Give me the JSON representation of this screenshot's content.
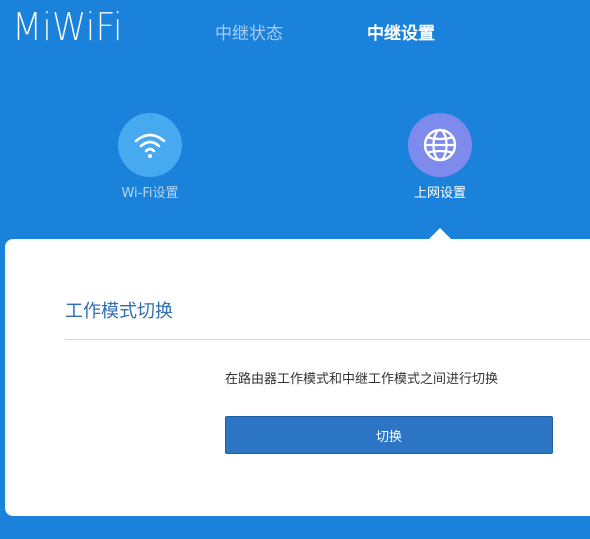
{
  "header": {
    "logo_text": "MiWiFi",
    "nav": {
      "status_label": "中继状态",
      "settings_label": "中继设置"
    }
  },
  "settings_menu": {
    "wifi_label": "Wi-Fi设置",
    "network_label": "上网设置",
    "wifi_icon": "wifi-icon",
    "network_icon": "globe-icon"
  },
  "panel": {
    "title": "工作模式切换",
    "description": "在路由器工作模式和中继工作模式之间进行切换",
    "switch_button_label": "切换"
  },
  "colors": {
    "background": "#1b82dc",
    "wifi_circle": "#47a9ef",
    "network_circle": "#7e8bec",
    "panel_title": "#2d6fb3",
    "button": "#2c74c4"
  }
}
